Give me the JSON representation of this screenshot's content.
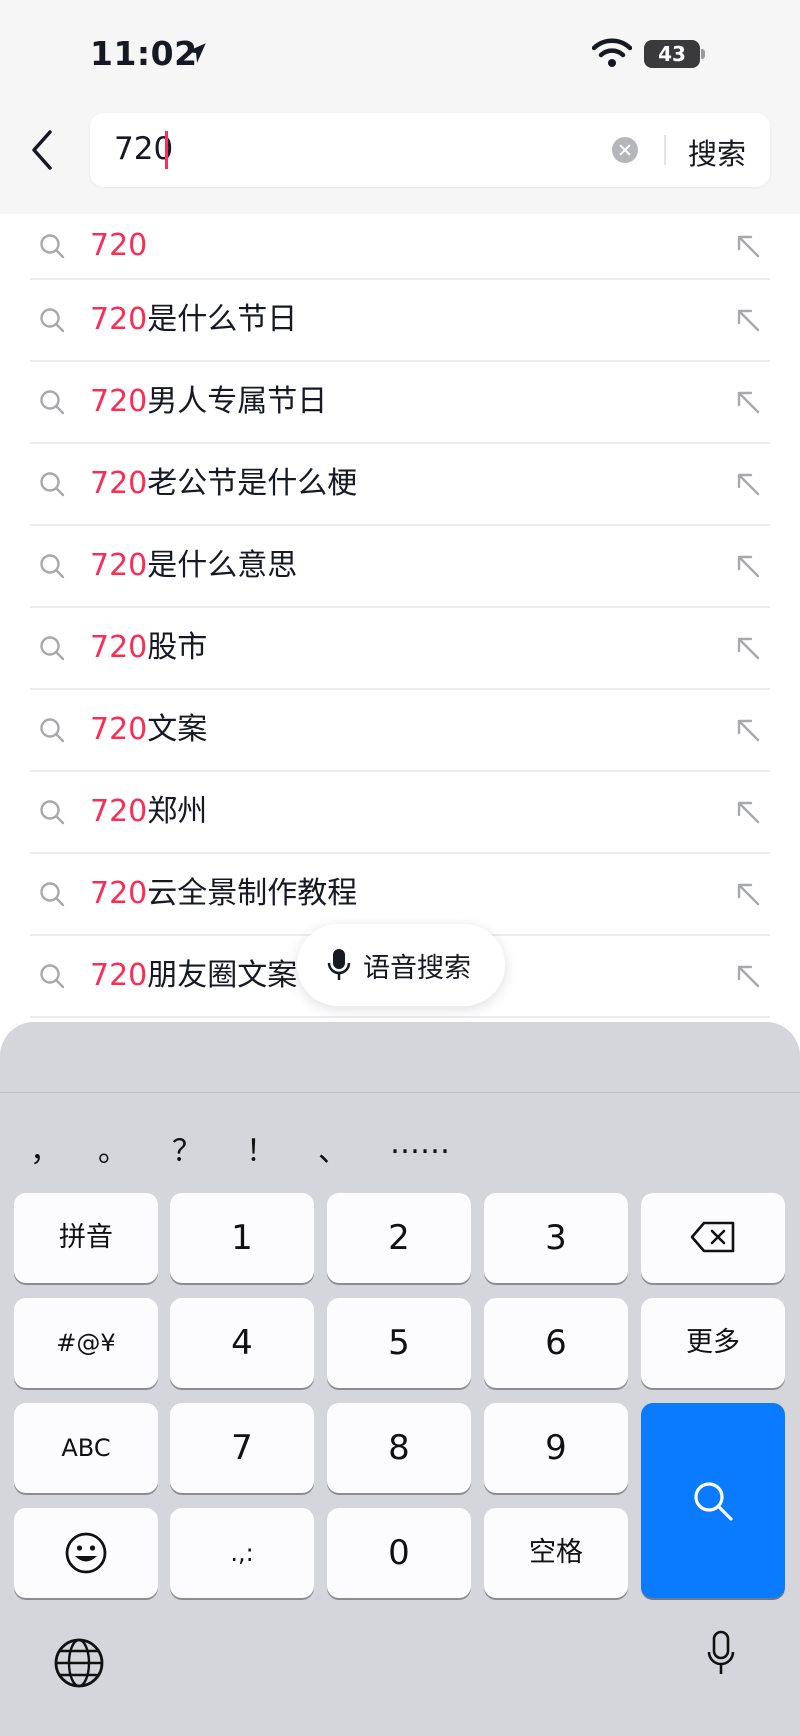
{
  "status_bar": {
    "time": "11:02",
    "battery": "43"
  },
  "search": {
    "query": "720",
    "submit_label": "搜索"
  },
  "suggestions": [
    {
      "highlight": "720",
      "rest": ""
    },
    {
      "highlight": "720",
      "rest": "是什么节日"
    },
    {
      "highlight": "720",
      "rest": "男人专属节日"
    },
    {
      "highlight": "720",
      "rest": "老公节是什么梗"
    },
    {
      "highlight": "720",
      "rest": "是什么意思"
    },
    {
      "highlight": "720",
      "rest": "股市"
    },
    {
      "highlight": "720",
      "rest": "文案"
    },
    {
      "highlight": "720",
      "rest": "郑州"
    },
    {
      "highlight": "720",
      "rest": "云全景制作教程"
    },
    {
      "highlight": "720",
      "rest": "朋友圈文案"
    }
  ],
  "voice_search": {
    "label": "语音搜索"
  },
  "keyboard": {
    "punctuation": [
      "，",
      "。",
      "？",
      "！",
      "、",
      "……"
    ],
    "rows": [
      [
        "拼音",
        "1",
        "2",
        "3",
        "delete"
      ],
      [
        "#@¥",
        "4",
        "5",
        "6",
        "更多"
      ],
      [
        "ABC",
        "7",
        "8",
        "9",
        "search"
      ],
      [
        "emoji",
        ".,:",
        "0",
        "空格"
      ]
    ]
  },
  "colors": {
    "highlight": "#fe2c55",
    "accent": "#0a7aff"
  },
  "icons": [
    "location-arrow-icon",
    "wifi-icon",
    "back-chevron-icon",
    "clear-icon",
    "search-icon",
    "fill-arrow-icon",
    "microphone-icon",
    "delete-icon",
    "emoji-icon",
    "globe-icon"
  ]
}
